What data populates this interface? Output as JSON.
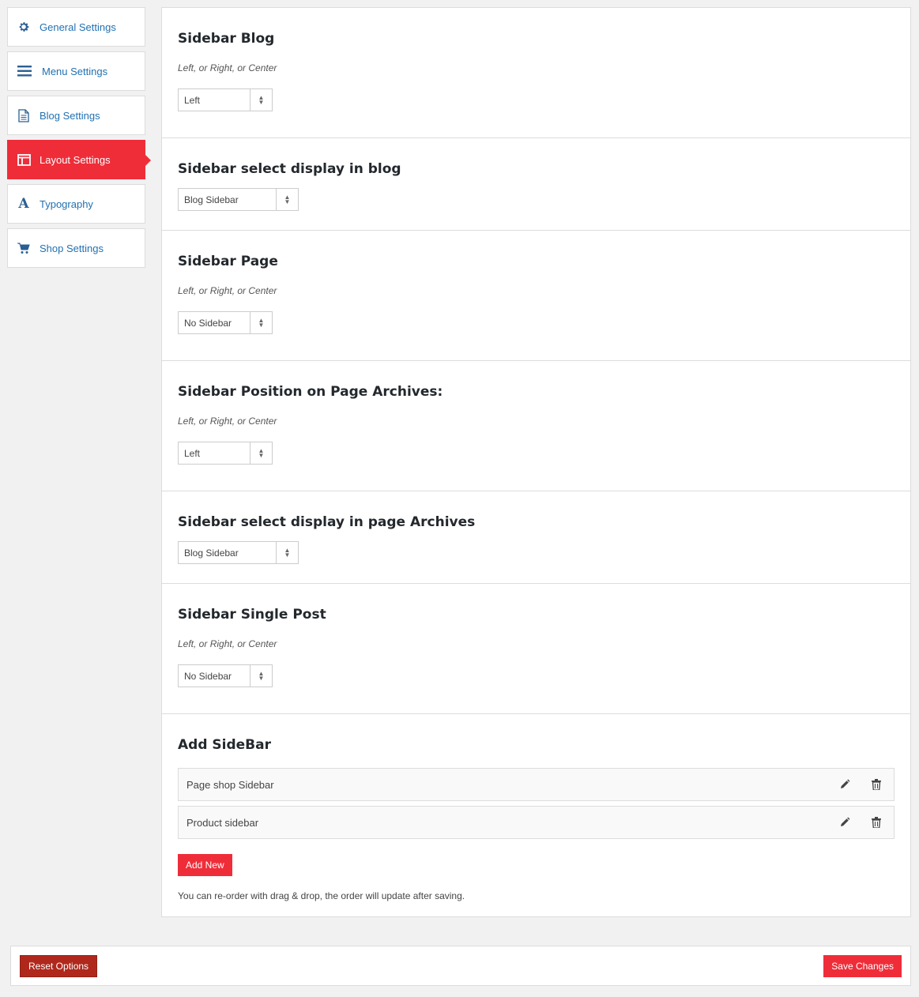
{
  "nav": {
    "items": [
      {
        "label": "General Settings",
        "icon": "gear-icon"
      },
      {
        "label": "Menu Settings",
        "icon": "menu-lines-icon"
      },
      {
        "label": "Blog Settings",
        "icon": "document-icon"
      },
      {
        "label": "Layout Settings",
        "icon": "layout-icon",
        "active": true
      },
      {
        "label": "Typography",
        "icon": "typography-icon"
      },
      {
        "label": "Shop Settings",
        "icon": "cart-icon"
      }
    ]
  },
  "sections": {
    "sidebar_blog": {
      "title": "Sidebar Blog",
      "desc": "Left, or Right, or Center",
      "value": "Left"
    },
    "sidebar_blog_display": {
      "title": "Sidebar select display in blog",
      "value": "Blog Sidebar"
    },
    "sidebar_page": {
      "title": "Sidebar Page",
      "desc": "Left, or Right, or Center",
      "value": "No Sidebar"
    },
    "sidebar_page_archives": {
      "title": "Sidebar Position on Page Archives:",
      "desc": "Left, or Right, or Center",
      "value": "Left"
    },
    "sidebar_archives_display": {
      "title": "Sidebar select display in page Archives",
      "value": "Blog Sidebar"
    },
    "sidebar_single_post": {
      "title": "Sidebar Single Post",
      "desc": "Left, or Right, or Center",
      "value": "No Sidebar"
    },
    "add_sidebar": {
      "title": "Add SideBar",
      "items": [
        "Page shop Sidebar",
        "Product sidebar"
      ],
      "add_label": "Add New",
      "note": "You can re-order with drag & drop, the order will update after saving."
    }
  },
  "footer": {
    "reset_label": "Reset Options",
    "save_label": "Save Changes"
  },
  "colors": {
    "accent": "#ef2d39",
    "reset": "#b0281c",
    "link": "#2271b1"
  }
}
